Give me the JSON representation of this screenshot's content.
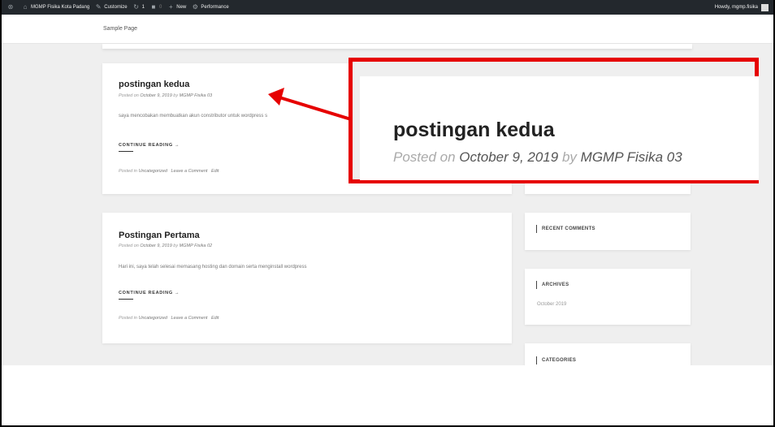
{
  "admin_bar": {
    "wp_logo": "wordpress-icon",
    "site_name": "MGMP Fisika Kota Padang",
    "customize": "Customize",
    "updates_count": "1",
    "comments_count": "0",
    "new_label": "New",
    "performance": "Performance",
    "greeting": "Howdy, mgmp.fisika"
  },
  "header": {
    "menu": [
      "Sample Page"
    ]
  },
  "posts": [
    {
      "title": "postingan kedua",
      "meta_prefix": "Posted on",
      "date": "October 9, 2019",
      "by": "by",
      "author": "MGMP Fisika 03",
      "excerpt": "saya mencobakan membuatkan akun constributor untuk wordpress s",
      "continue": "CONTINUE READING →",
      "posted_in": "Posted in",
      "category": "Uncategorized",
      "comment": "Leave a Comment",
      "edit": "Edit"
    },
    {
      "title": "Postingan Pertama",
      "meta_prefix": "Posted on",
      "date": "October 9, 2019",
      "by": "by",
      "author": "MGMP Fisika 02",
      "excerpt": "Hari ini, saya telah selesai memasang hosting dan domain serta menginstall wordpress",
      "continue": "CONTINUE READING →",
      "posted_in": "Posted in",
      "category": "Uncategorized",
      "comment": "Leave a Comment",
      "edit": "Edit"
    }
  ],
  "sidebar": {
    "recent_comments": "RECENT COMMENTS",
    "archives": "ARCHIVES",
    "archive_item": "October 2019",
    "categories": "CATEGORIES"
  },
  "zoom": {
    "title": "postingan kedua",
    "meta_prefix": "Posted on",
    "date": "October 9, 2019",
    "by": "by",
    "author": "MGMP Fisika 03"
  },
  "colors": {
    "highlight_red": "#e60000",
    "admin_bar_bg": "#23282d",
    "page_bg": "#efefef"
  }
}
